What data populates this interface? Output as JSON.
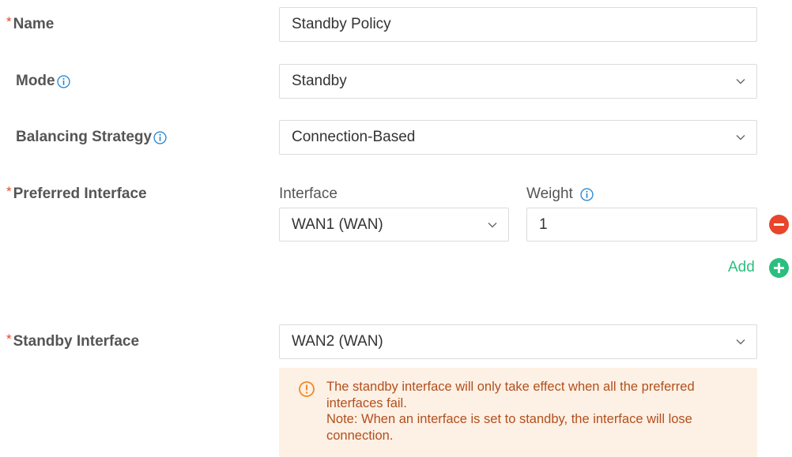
{
  "name": {
    "required_mark": "*",
    "label": "Name",
    "value": "Standby Policy"
  },
  "mode": {
    "label": "Mode",
    "value": "Standby",
    "info_icon": "info-icon"
  },
  "balancing_strategy": {
    "label": "Balancing Strategy",
    "value": "Connection-Based",
    "info_icon": "info-icon"
  },
  "preferred_interface": {
    "required_mark": "*",
    "label": "Preferred Interface",
    "interface_header": "Interface",
    "weight_header": "Weight",
    "interface_value": "WAN1 (WAN)",
    "weight_value": "1",
    "add_label": "Add"
  },
  "standby_interface": {
    "required_mark": "*",
    "label": "Standby Interface",
    "value": "WAN2 (WAN)"
  },
  "warning": {
    "line1": "The standby interface will only take effect when all the preferred interfaces fail.",
    "line2": "Note: When an interface is set to standby, the interface will lose connection.",
    "icon": "warning-circle-icon"
  },
  "colors": {
    "required": "#e8452c",
    "info": "#2a8ad4",
    "add": "#2bbf7f",
    "remove": "#e8452c",
    "warning_bg": "#fdf0e4",
    "warning_text": "#b1501e"
  }
}
